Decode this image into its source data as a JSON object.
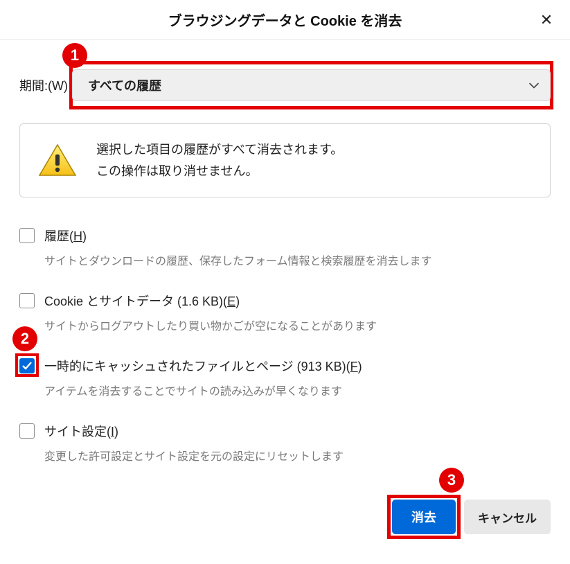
{
  "dialog": {
    "title": "ブラウジングデータと Cookie を消去",
    "close_label": "✕"
  },
  "period": {
    "label": "期間:(W)",
    "selected": "すべての履歴"
  },
  "warning": {
    "line1": "選択した項目の履歴がすべて消去されます。",
    "line2": "この操作は取り消せません。"
  },
  "items": {
    "history": {
      "label_pre": "履歴(",
      "label_u": "H",
      "label_post": ")",
      "desc": "サイトとダウンロードの履歴、保存したフォーム情報と検索履歴を消去します",
      "checked": false
    },
    "cookies": {
      "label_pre": "Cookie とサイトデータ (1.6 KB)(",
      "label_u": "E",
      "label_post": ")",
      "desc": "サイトからログアウトしたり買い物かごが空になることがあります",
      "checked": false
    },
    "cache": {
      "label_pre": "一時的にキャッシュされたファイルとページ (913 KB)(",
      "label_u": "F",
      "label_post": ")",
      "desc": "アイテムを消去することでサイトの読み込みが早くなります",
      "checked": true
    },
    "settings": {
      "label_pre": "サイト設定(",
      "label_u": "I",
      "label_post": ")",
      "desc": "変更した許可設定とサイト設定を元の設定にリセットします",
      "checked": false
    }
  },
  "buttons": {
    "clear": "消去",
    "cancel": "キャンセル"
  },
  "callouts": {
    "c1": "1",
    "c2": "2",
    "c3": "3"
  }
}
